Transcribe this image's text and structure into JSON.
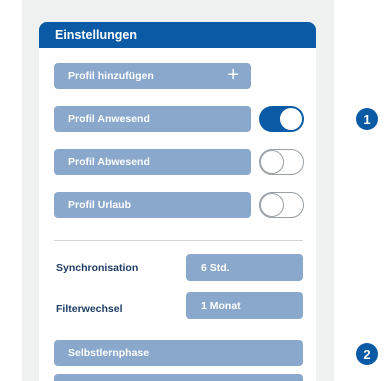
{
  "settings": {
    "title": "Einstellungen",
    "add_profile": {
      "label": "Profil hinzufügen",
      "icon": "plus-icon"
    },
    "profiles": [
      {
        "label": "Profil Anwesend",
        "enabled": true
      },
      {
        "label": "Profil Abwesend",
        "enabled": false
      },
      {
        "label": "Profil Urlaub",
        "enabled": false
      }
    ],
    "sync": {
      "label": "Synchronisation",
      "value": "6 Std."
    },
    "filter": {
      "label": "Filterwechsel",
      "value": "1 Monat"
    },
    "learning_phase": {
      "label": "Selbstlernphase"
    }
  },
  "callouts": [
    "1",
    "2"
  ],
  "colors": {
    "header_blue": "#0a5aa6",
    "pill_blue": "#8aa7cc",
    "label_navy": "#1e3e66",
    "background_grey": "#eff0f0"
  }
}
